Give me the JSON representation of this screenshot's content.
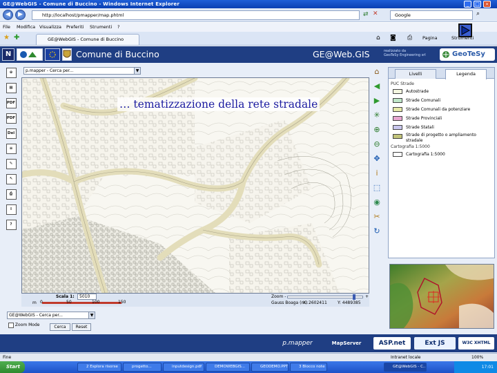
{
  "browser": {
    "title": "GE@WebGIS - Comune di Buccino - Windows Internet Explorer",
    "url": "http://localhost/pmapper/map.phtml",
    "search_placeholder": "Google",
    "menu": [
      "File",
      "Modifica",
      "Visualizza",
      "Preferiti",
      "Strumenti",
      "?"
    ],
    "tab_label": "GE@WebGIS - Comune di Buccino",
    "commands": [
      "Pagina",
      "Strumenti"
    ]
  },
  "app": {
    "title": "Comune di Buccino",
    "brand": "GE@Web.GIS",
    "brand_sub_1": "realizzato da",
    "brand_sub_2": "GeoTeSy Engineering srl",
    "partner_logo": "GeoTeSy"
  },
  "search": {
    "value": "p.mapper - Cerca per..."
  },
  "map": {
    "overlay_text": "… tematizzazione della rete stradale",
    "scale_label": "Scala 1:",
    "scale_value": "5010",
    "scalebar_unit": "m",
    "scalebar_ticks": [
      "0",
      "50",
      "100",
      "150"
    ],
    "zoom_label": "Zoom -",
    "zoom_plus": "+",
    "coords_label": "Gauss Boaga (m):",
    "coord_x": "X: 2602411",
    "coord_y": "Y: 4489385"
  },
  "left_tools": [
    {
      "name": "zoom-in-tool",
      "label": "⊕"
    },
    {
      "name": "table-tool",
      "label": "▦"
    },
    {
      "name": "pdf-tool",
      "label": "PDF"
    },
    {
      "name": "pdf-tool-2",
      "label": "PDF"
    },
    {
      "name": "del-tool",
      "label": "Del"
    },
    {
      "name": "layers-tool",
      "label": "≡"
    },
    {
      "name": "ruler-tool",
      "label": "✎"
    },
    {
      "name": "coordinates-tool",
      "label": "↖"
    },
    {
      "name": "print-tool",
      "label": "⎙"
    },
    {
      "name": "download-tool",
      "label": "⇩"
    },
    {
      "name": "help-tool",
      "label": "?"
    }
  ],
  "right_tools": [
    {
      "name": "home-icon",
      "glyph": "⌂",
      "color": "#8a5a1a"
    },
    {
      "name": "back-arrow-icon",
      "glyph": "◀",
      "color": "#2f9a2f"
    },
    {
      "name": "forward-arrow-icon",
      "glyph": "▶",
      "color": "#2f9a2f"
    },
    {
      "name": "refresh-icon",
      "glyph": "✳",
      "color": "#2a7a2a"
    },
    {
      "name": "zoom-in-icon",
      "glyph": "⊕",
      "color": "#2a7a2a"
    },
    {
      "name": "zoom-out-icon",
      "glyph": "⊖",
      "color": "#2a7a2a"
    },
    {
      "name": "pan-icon",
      "glyph": "✥",
      "color": "#1a5ab0"
    },
    {
      "name": "identify-icon",
      "glyph": "i",
      "color": "#b07a1a"
    },
    {
      "name": "select-icon",
      "glyph": "⬚",
      "color": "#1a5ab0"
    },
    {
      "name": "globe-icon",
      "glyph": "◉",
      "color": "#2f8a4f"
    },
    {
      "name": "measure-icon",
      "glyph": "✂",
      "color": "#b07a1a"
    },
    {
      "name": "reload-icon",
      "glyph": "↻",
      "color": "#1a5ab0"
    }
  ],
  "panel": {
    "tabs": [
      "Livelli",
      "Legenda"
    ],
    "active_tab": "Legenda",
    "legend": [
      {
        "group": "PUC Strade",
        "items": [
          {
            "label": "Autostrade",
            "color": "#f4f6e0"
          },
          {
            "label": "Strade Comunali",
            "color": "#bfe6c8"
          },
          {
            "label": "Strade Comunali da potenziare",
            "color": "#e7eaa8"
          },
          {
            "label": "Strade Provinciali",
            "color": "#e8a6d0"
          },
          {
            "label": "Strade Statali",
            "color": "#c9c7ee"
          },
          {
            "label": "Strade di progetto o ampliamento stradale",
            "color": "#c2c47a"
          }
        ]
      },
      {
        "group": "Cartografia 1:5000",
        "items": [
          {
            "label": "Cartografia 1:5000",
            "color": "#ffffff"
          }
        ]
      }
    ]
  },
  "bottom": {
    "search_value": "GE@WebGIS - Cerca per...",
    "zoom_mode_label": "Zoom Mode",
    "find_button": "Cerca",
    "reset_button": "Reset"
  },
  "footer": {
    "logos": [
      "p.mapper",
      "MapServer",
      "ASP.net",
      "Ext JS",
      "W3C XHTML 1.0"
    ]
  },
  "status": {
    "left": "Fine",
    "zone": "Intranet locale",
    "zoom": "100%"
  },
  "taskbar": {
    "start": "Start",
    "tasks": [
      "2 Esplora risorse",
      "progetto...",
      "inputdesign.pdf",
      "DEMOWEBGIS...",
      "GEODEMO.PPT",
      "3 Blocco note",
      "GE@WebGIS - C..."
    ],
    "clock": "17:01"
  }
}
